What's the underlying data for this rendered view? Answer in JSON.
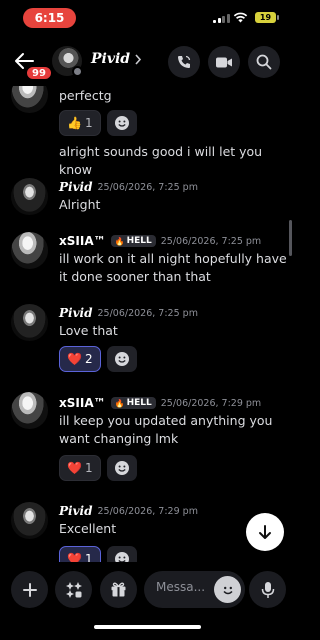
{
  "status_bar": {
    "time": "6:15",
    "battery": "19"
  },
  "header": {
    "unread_badge": "99",
    "channel_name": "Pivid",
    "actions": [
      "phone-icon",
      "video-icon",
      "search-icon"
    ]
  },
  "messages": [
    {
      "text": "perfectg",
      "reactions": [
        {
          "emoji": "👍",
          "count": "1",
          "mine": false
        }
      ]
    },
    {
      "text": "alright sounds good i will let you know"
    },
    {
      "author": "Pivid",
      "timestamp": "25/06/2026, 7:25 pm",
      "text": "Alright"
    },
    {
      "author": "xSIIA™",
      "tag": "HELL",
      "timestamp": "25/06/2026, 7:25 pm",
      "text": "ill work on it all night hopefully have it done sooner than that"
    },
    {
      "author": "Pivid",
      "timestamp": "25/06/2026, 7:25 pm",
      "text": "Love that",
      "reactions": [
        {
          "emoji": "❤️",
          "count": "2",
          "mine": true
        }
      ]
    },
    {
      "author": "xSIIA™",
      "tag": "HELL",
      "timestamp": "25/06/2026, 7:29 pm",
      "text": "ill keep you updated anything you want changing lmk",
      "reactions": [
        {
          "emoji": "❤️",
          "count": "1",
          "mine": false
        }
      ]
    },
    {
      "author": "Pivid",
      "timestamp": "25/06/2026, 7:29 pm",
      "text": "Excellent",
      "reactions": [
        {
          "emoji": "❤️",
          "count": "1",
          "mine": true
        }
      ]
    }
  ],
  "composer": {
    "placeholder": "Messa..."
  },
  "colors": {
    "accent": "#5b63d9",
    "time_pill": "#e7443d",
    "badge": "#e53b3b",
    "battery": "#d7d13c"
  }
}
